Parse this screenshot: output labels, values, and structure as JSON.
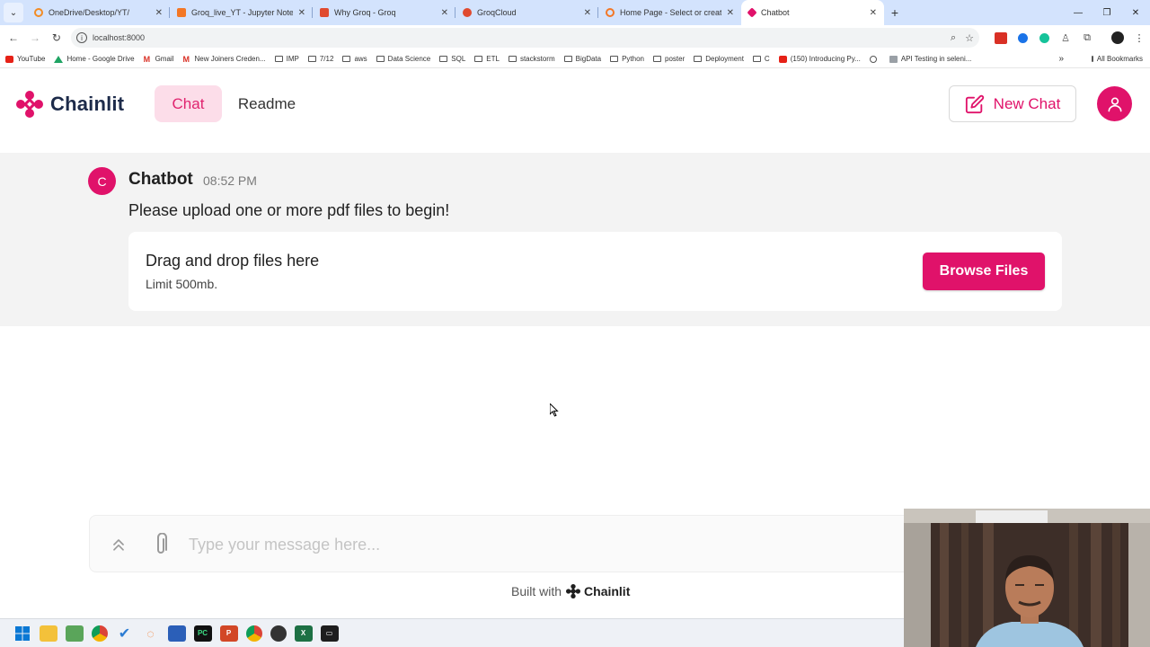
{
  "browser": {
    "tabs": [
      {
        "label": "OneDrive/Desktop/YT/",
        "favicon_color": "#f28b24",
        "active": false
      },
      {
        "label": "Groq_live_YT - Jupyter Notebook",
        "favicon_color": "#f37726",
        "active": false
      },
      {
        "label": "Why Groq - Groq",
        "favicon_color": "#e04a2f",
        "active": false
      },
      {
        "label": "GroqCloud",
        "favicon_color": "#e04a2f",
        "active": false
      },
      {
        "label": "Home Page - Select or create a notebook",
        "favicon_color": "#f37726",
        "active": false
      },
      {
        "label": "Chatbot",
        "favicon_color": "#e0126a",
        "active": true
      }
    ],
    "address": "localhost:8000",
    "bookmarks": [
      {
        "label": "YouTube",
        "icon": "youtube-icon"
      },
      {
        "label": "Home - Google Drive",
        "icon": "drive-icon"
      },
      {
        "label": "Gmail",
        "icon": "gmail-icon"
      },
      {
        "label": "New Joiners Creden...",
        "icon": "gmail-icon"
      },
      {
        "label": "IMP",
        "icon": "folder-icon"
      },
      {
        "label": "7/12",
        "icon": "folder-icon"
      },
      {
        "label": "aws",
        "icon": "folder-icon"
      },
      {
        "label": "Data Science",
        "icon": "folder-icon"
      },
      {
        "label": "SQL",
        "icon": "folder-icon"
      },
      {
        "label": "ETL",
        "icon": "folder-icon"
      },
      {
        "label": "stackstorm",
        "icon": "folder-icon"
      },
      {
        "label": "BigData",
        "icon": "folder-icon"
      },
      {
        "label": "Python",
        "icon": "folder-icon"
      },
      {
        "label": "poster",
        "icon": "folder-icon"
      },
      {
        "label": "Deployment",
        "icon": "folder-icon"
      },
      {
        "label": "C",
        "icon": "folder-icon"
      },
      {
        "label": "(150) Introducing Py...",
        "icon": "youtube-icon"
      },
      {
        "label": "",
        "icon": "history-icon"
      },
      {
        "label": "API Testing in seleni...",
        "icon": "page-icon"
      }
    ],
    "bookmarks_more": "»",
    "all_bookmarks": "All Bookmarks"
  },
  "app": {
    "brand": "Chainlit",
    "nav": {
      "chat": "Chat",
      "readme": "Readme"
    },
    "new_chat": "New Chat",
    "accent_color": "#e0126a"
  },
  "message": {
    "avatar_letter": "C",
    "author": "Chatbot",
    "time": "08:52 PM",
    "text": "Please upload one or more pdf files to begin!",
    "dropzone": {
      "title": "Drag and drop files here",
      "limit": "Limit 500mb.",
      "button": "Browse Files"
    }
  },
  "composer": {
    "placeholder": "Type your message here..."
  },
  "footer": {
    "built_with": "Built with",
    "brand": "Chainlit"
  }
}
